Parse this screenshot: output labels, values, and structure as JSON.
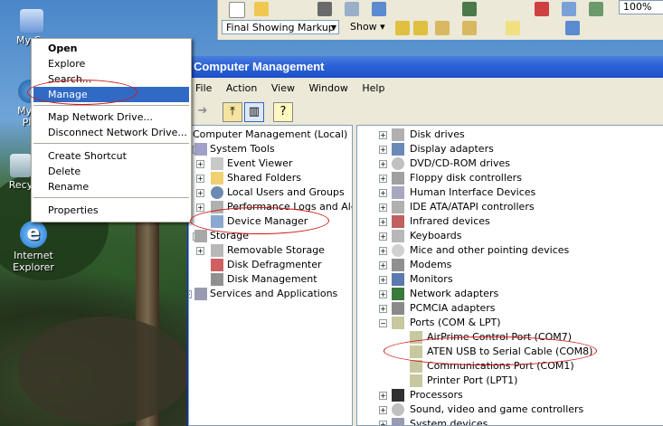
{
  "desktop": {
    "icons": [
      {
        "label": "My Co",
        "icon": "my-computer-icon"
      },
      {
        "label": "My N",
        "icon": "my-network-places-icon"
      },
      {
        "label": "Pla",
        "icon": "my-network-places-icon"
      },
      {
        "label": "Recy",
        "icon": "recycle-bin-icon"
      },
      {
        "label": "Internet",
        "icon": "internet-explorer-icon"
      },
      {
        "label": "Explorer",
        "icon": "internet-explorer-icon"
      }
    ]
  },
  "word_toolbar": {
    "markup_select": "Final Showing Markup",
    "show_label": "Show",
    "zoom": "100%"
  },
  "context_menu": {
    "items": [
      "Open",
      "Explore",
      "Search...",
      "Manage",
      "Map Network Drive...",
      "Disconnect Network Drive...",
      "Create Shortcut",
      "Delete",
      "Rename",
      "Properties"
    ]
  },
  "window": {
    "title": "Computer Management",
    "menu": [
      "File",
      "Action",
      "View",
      "Window",
      "Help"
    ]
  },
  "tree": {
    "root": "Computer Management (Local)",
    "items": [
      "System Tools",
      "Event Viewer",
      "Shared Folders",
      "Local Users and Groups",
      "Performance Logs and Alerts",
      "Device Manager",
      "Storage",
      "Removable Storage",
      "Disk Defragmenter",
      "Disk Management",
      "Services and Applications"
    ]
  },
  "devices": {
    "items": [
      "Disk drives",
      "Display adapters",
      "DVD/CD-ROM drives",
      "Floppy disk controllers",
      "Human Interface Devices",
      "IDE ATA/ATAPI controllers",
      "Infrared devices",
      "Keyboards",
      "Mice and other pointing devices",
      "Modems",
      "Monitors",
      "Network adapters",
      "PCMCIA adapters",
      "Ports (COM & LPT)",
      "AirPrime Control Port (COM7)",
      "ATEN USB to Serial Cable (COM8)",
      "Communications Port (COM1)",
      "Printer Port (LPT1)",
      "Processors",
      "Sound, video and game controllers",
      "System devices"
    ]
  },
  "colors": {
    "selection": "#316ac5",
    "titlebar": "#2f64d8",
    "annotation": "#d01818"
  }
}
